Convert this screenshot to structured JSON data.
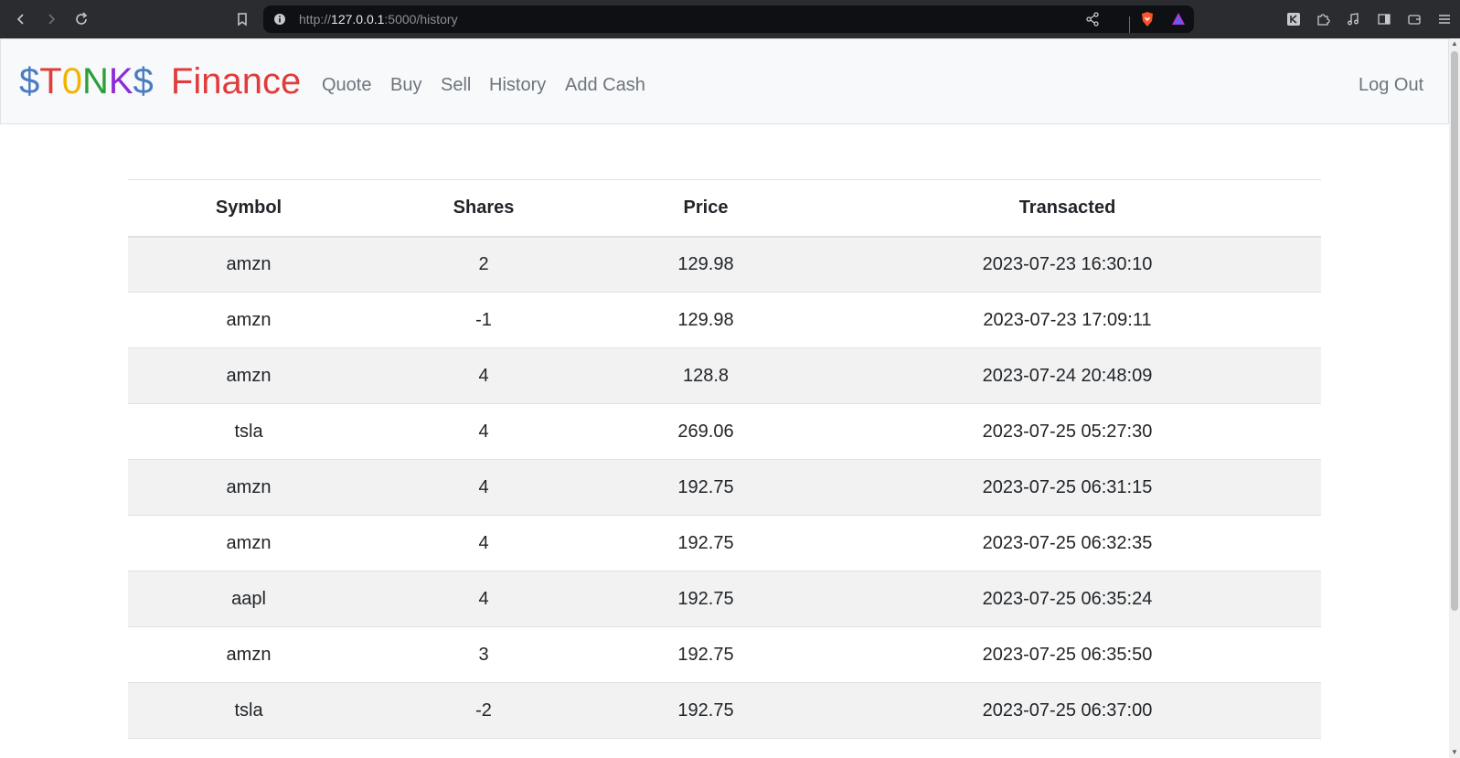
{
  "browser": {
    "url_scheme": "http://",
    "url_host": "127.0.0.1",
    "url_path": ":5000/history"
  },
  "navbar": {
    "brand": {
      "letters": [
        {
          "char": "$",
          "color": "#4a7bc4"
        },
        {
          "char": "T",
          "color": "#e03c3c"
        },
        {
          "char": "0",
          "color": "#f0b400"
        },
        {
          "char": "N",
          "color": "#2e9e3a"
        },
        {
          "char": "K",
          "color": "#8c2ad8"
        },
        {
          "char": "$",
          "color": "#4a7bc4"
        }
      ],
      "brand_word": "STONKS",
      "finance": "Finance",
      "finance_color": "#e03c3c"
    },
    "links": {
      "quote": "Quote",
      "buy": "Buy",
      "sell": "Sell",
      "history": "History",
      "add_cash": "Add Cash"
    },
    "logout": "Log Out"
  },
  "table": {
    "headers": [
      "Symbol",
      "Shares",
      "Price",
      "Transacted"
    ],
    "rows": [
      [
        "amzn",
        "2",
        "129.98",
        "2023-07-23 16:30:10"
      ],
      [
        "amzn",
        "-1",
        "129.98",
        "2023-07-23 17:09:11"
      ],
      [
        "amzn",
        "4",
        "128.8",
        "2023-07-24 20:48:09"
      ],
      [
        "tsla",
        "4",
        "269.06",
        "2023-07-25 05:27:30"
      ],
      [
        "amzn",
        "4",
        "192.75",
        "2023-07-25 06:31:15"
      ],
      [
        "amzn",
        "4",
        "192.75",
        "2023-07-25 06:32:35"
      ],
      [
        "aapl",
        "4",
        "192.75",
        "2023-07-25 06:35:24"
      ],
      [
        "amzn",
        "3",
        "192.75",
        "2023-07-25 06:35:50"
      ],
      [
        "tsla",
        "-2",
        "192.75",
        "2023-07-25 06:37:00"
      ]
    ]
  }
}
